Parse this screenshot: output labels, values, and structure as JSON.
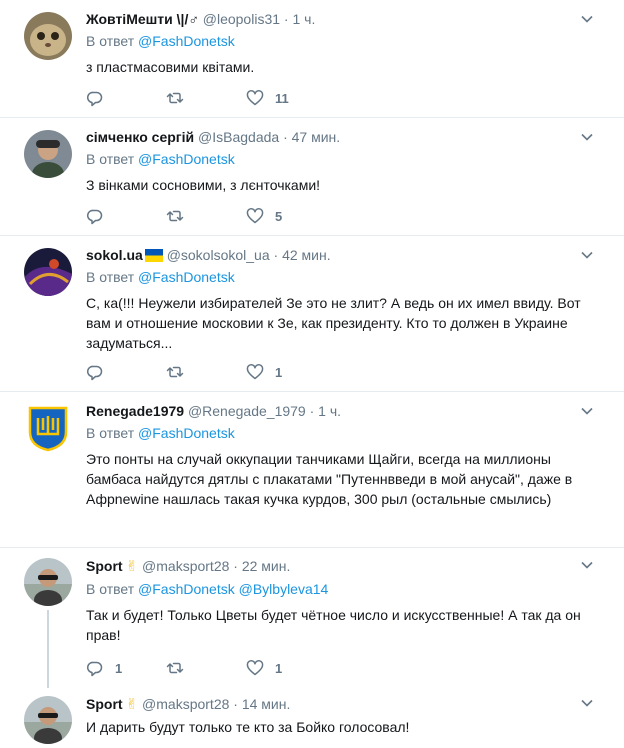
{
  "reply_prefix": "В ответ",
  "tweets": [
    {
      "fullname": "ЖовтіМешти \\|/♂",
      "handle": "@leopolis31",
      "dot": "·",
      "time": "1 ч.",
      "reply_to": "@FashDonetsk",
      "text": "з пластмасовими квітами.",
      "reply_count": "",
      "like_count": "11"
    },
    {
      "fullname": "сімченко сергій",
      "handle": "@IsBagdada",
      "dot": "·",
      "time": "47 мин.",
      "reply_to": "@FashDonetsk",
      "text": "З вінками сосновими, з лєнточками!",
      "reply_count": "",
      "like_count": "5"
    },
    {
      "fullname": "sokol.ua",
      "handle": "@sokolsokol_ua",
      "dot": "·",
      "time": "42 мин.",
      "reply_to": "@FashDonetsk",
      "text": "С, ка(!!! Неужели избирателей Зе это не злит? А ведь он их имел ввиду. Вот вам и отношение московии к Зе, как президенту. Кто то должен в Украине задуматься...",
      "reply_count": "",
      "like_count": "1"
    },
    {
      "fullname": "Renegade1979",
      "handle": "@Renegade_1979",
      "dot": "·",
      "time": "1 ч.",
      "reply_to": "@FashDonetsk",
      "text": "Это понты на случай оккупации танчиками Щайги, всегда на миллионы бамбаса найдутся дятлы с плакатами \"Путеннвведи в мой анусай\", даже в Афрnewine нашлась такая кучка курдов, 300 рыл (остальные смылись)",
      "reply_count": "",
      "like_count": ""
    },
    {
      "fullname": "Sport",
      "handle": "@maksport28",
      "dot": "·",
      "time": "22 мин.",
      "reply_to": "@FashDonetsk",
      "reply_to_2": "@Bylbyleva14",
      "text": "Так и будет! Только Цветы будет чётное число и искусственные! А так да он прав!",
      "reply_count": "1",
      "like_count": "1"
    },
    {
      "fullname": "Sport",
      "handle": "@maksport28",
      "dot": "·",
      "time": "14 мин.",
      "text": "И дарить будут только те кто за Бойко голосовал!"
    }
  ],
  "colors": {
    "link": "#1b95e0",
    "muted": "#657786",
    "flag_blue": "#0057b7",
    "flag_yellow": "#ffd700",
    "emblem_blue": "#1565c0",
    "emblem_yellow": "#f9c400"
  },
  "icons": [
    "caret-down-icon",
    "reply-icon",
    "retweet-icon",
    "like-icon",
    "ukraine-flag-icon",
    "peace-hand-icon"
  ]
}
